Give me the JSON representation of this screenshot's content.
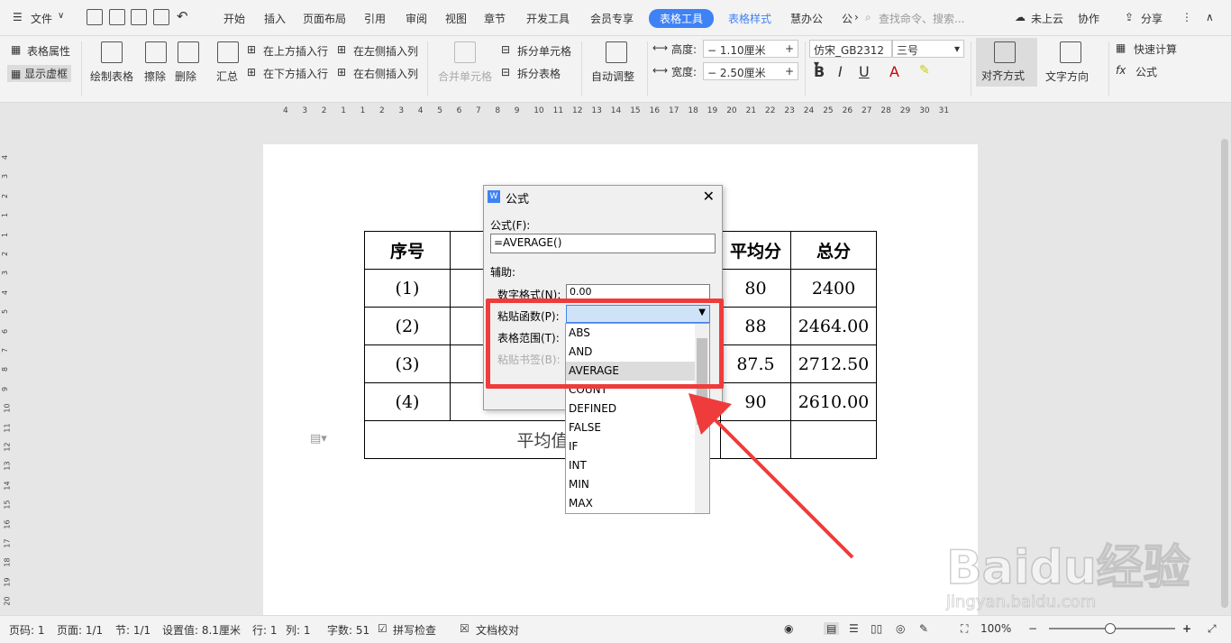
{
  "menubar": {
    "file": "文件",
    "tabs": [
      "开始",
      "插入",
      "页面布局",
      "引用",
      "审阅",
      "视图",
      "章节",
      "开发工具",
      "会员专享",
      "表格工具",
      "表格样式",
      "慧办公",
      "公"
    ],
    "active_tab": "表格工具",
    "search_placeholder": "查找命令、搜索...",
    "cloud": "未上云",
    "collab": "协作",
    "share": "分享"
  },
  "ribbon": {
    "table_props": "表格属性",
    "show_gridlines": "显示虚框",
    "draw_table": "绘制表格",
    "erase": "擦除",
    "delete": "删除",
    "summary": "汇总",
    "insert_above": "在上方插入行",
    "insert_below": "在下方插入行",
    "insert_left": "在左侧插入列",
    "insert_right": "在右侧插入列",
    "merge_cells": "合并单元格",
    "split_cells": "拆分单元格",
    "split_table": "拆分表格",
    "auto_fit": "自动调整",
    "height_label": "高度:",
    "height_value": "1.10厘米",
    "width_label": "宽度:",
    "width_value": "2.50厘米",
    "font_name": "仿宋_GB2312",
    "font_size": "三号",
    "align": "对齐方式",
    "text_direction": "文字方向",
    "quick_calc": "快速计算",
    "formula": "公式",
    "fx": "fx"
  },
  "ruler": {
    "numbers": [
      "4",
      "3",
      "2",
      "1",
      "1",
      "2",
      "3",
      "4",
      "5",
      "6",
      "7",
      "8",
      "9",
      "10",
      "11",
      "12",
      "13",
      "14",
      "15",
      "16",
      "17",
      "18",
      "19",
      "20",
      "21",
      "22",
      "23",
      "24",
      "25",
      "26",
      "27",
      "28",
      "29",
      "30",
      "31"
    ]
  },
  "vruler": {
    "numbers": [
      "4",
      "3",
      "2",
      "1",
      "1",
      "2",
      "3",
      "4",
      "5",
      "6",
      "7",
      "8",
      "9",
      "10",
      "11",
      "12",
      "13",
      "14",
      "15",
      "16",
      "17",
      "18",
      "19",
      "20"
    ]
  },
  "document": {
    "header": [
      "序号",
      "",
      "",
      "平均分",
      "总分"
    ],
    "rows": [
      [
        "(1)",
        "",
        "",
        "80",
        "2400"
      ],
      [
        "(2)",
        "",
        "",
        "88",
        "2464.00"
      ],
      [
        "(3)",
        "",
        "",
        "87.5",
        "2712.50"
      ],
      [
        "(4)",
        "",
        "",
        "90",
        "2610.00"
      ]
    ],
    "footer_label": "平均值"
  },
  "dialog": {
    "title": "公式",
    "formula_label": "公式(F):",
    "formula_value": "=AVERAGE()",
    "aux_label": "辅助:",
    "number_format_label": "数字格式(N):",
    "number_format_value": "0.00",
    "paste_function_label": "粘贴函数(P):",
    "table_range_label": "表格范围(T):",
    "paste_bookmark_label": "粘贴书签(B):"
  },
  "dropdown": {
    "options": [
      "ABS",
      "AND",
      "AVERAGE",
      "COUNT",
      "DEFINED",
      "FALSE",
      "IF",
      "INT",
      "MIN",
      "MAX"
    ],
    "selected": "AVERAGE"
  },
  "statusbar": {
    "page_code": "页码: 1",
    "pages": "页面: 1/1",
    "section": "节: 1/1",
    "setting": "设置值: 8.1厘米",
    "row": "行: 1",
    "col": "列: 1",
    "word_count": "字数: 51",
    "spell_check": "拼写检查",
    "doc_proof": "文档校对",
    "zoom": "100%"
  },
  "watermark": {
    "text": "Baidu经验",
    "url": "jingyan.baidu.com"
  },
  "colors": {
    "accent": "#3f82f6",
    "highlight_red": "#ef3b3b"
  }
}
